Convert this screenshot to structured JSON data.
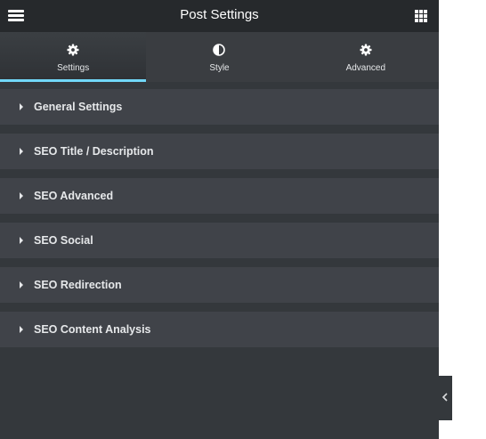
{
  "header": {
    "title": "Post Settings",
    "menu_icon": "hamburger-icon",
    "apps_icon": "grid-icon"
  },
  "tabs": [
    {
      "label": "Settings",
      "icon": "gear-icon",
      "active": true
    },
    {
      "label": "Style",
      "icon": "half-circle-icon",
      "active": false
    },
    {
      "label": "Advanced",
      "icon": "gear-icon",
      "active": false
    }
  ],
  "sections": [
    {
      "label": "General Settings"
    },
    {
      "label": "SEO Title / Description"
    },
    {
      "label": "SEO Advanced"
    },
    {
      "label": "SEO Social"
    },
    {
      "label": "SEO Redirection"
    },
    {
      "label": "SEO Content Analysis"
    }
  ],
  "collapse_icon": "chevron-left-icon",
  "colors": {
    "panel_bg": "#34383c",
    "header_bg": "#26292c",
    "section_bg": "#404349",
    "active_tab_underline": "#71d7f7",
    "text": "#e6e8ea"
  }
}
